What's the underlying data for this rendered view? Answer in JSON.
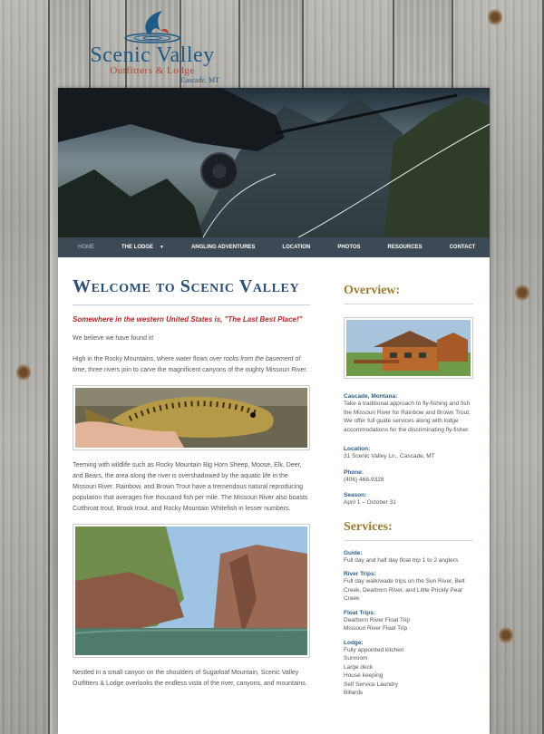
{
  "logo": {
    "name": "Scenic Valley",
    "subtitle": "Outfitters & Lodge",
    "location": "Cascade, MT"
  },
  "nav": {
    "items": [
      "HOME",
      "THE LODGE",
      "ANGLING ADVENTURES",
      "LOCATION",
      "PHOTOS",
      "RESOURCES",
      "CONTACT"
    ]
  },
  "main": {
    "title": "Welcome to Scenic Valley",
    "tagline": "Somewhere in the western United States is, \"The Last Best Place!\"",
    "intro": "We believe we have found it!",
    "p1_a": "High in the Rocky Mountains, where water flows ",
    "p1_em": "over rocks from the basement of time",
    "p1_b": ", three rivers join to carve the magnificent canyons of the mighty Missouri River.",
    "p2": "Teeming with wildlife such as Rocky Mountain Big Horn Sheep, Moose, Elk, Deer, and Bears, the area along the river is overshadowed by the aquatic life in the Missouri River. Rainbow, and Brown Trout have a tremendous natural reproducing population that averages five thousand fish per mile. The Missouri River also boasts Cutthroat trout, Brook trout, and Rocky Mountain Whitefish in lesser numbers.",
    "p3": "Nestled in a small canyon on the shoulders of Sugarloaf Mountain, Scenic Valley Outfitters & Lodge overlooks the endless vista of the river, canyons, and mountains."
  },
  "sidebar": {
    "overview_heading": "Overview:",
    "cascade_label": "Cascade, Montana:",
    "cascade_text": "Take a traditional approach to fly-fishing and fish the Missouri River for Rainbow and Brown Trout. We offer full guide services along with lodge accommodations for the discriminating fly-fisher.",
    "location_label": "Location:",
    "location_value": "31 Scenic Valley Ln., Cascade, MT",
    "phone_label": "Phone:",
    "phone_value": "(406) 468-9328",
    "season_label": "Season:",
    "season_value": "April 1 – October 31",
    "services_heading": "Services:",
    "services": [
      {
        "label": "Guide:",
        "lines": [
          "Full day and half day float trip 1 to 2 anglers"
        ]
      },
      {
        "label": "River Trips:",
        "lines": [
          "Full day walk/wade trips on the Sun River, Belt Creek, Dearborn River, and Little Prickly Pear Creek"
        ]
      },
      {
        "label": "Float Trips:",
        "lines": [
          "Dearborn River Float Trip",
          "Missouri River Float Trip"
        ]
      },
      {
        "label": "Lodge:",
        "lines": [
          "Fully appointed kitchen",
          "Sunroom",
          "Large deck",
          "House keeping",
          "Self Service Laundry",
          "Billards"
        ]
      }
    ]
  }
}
